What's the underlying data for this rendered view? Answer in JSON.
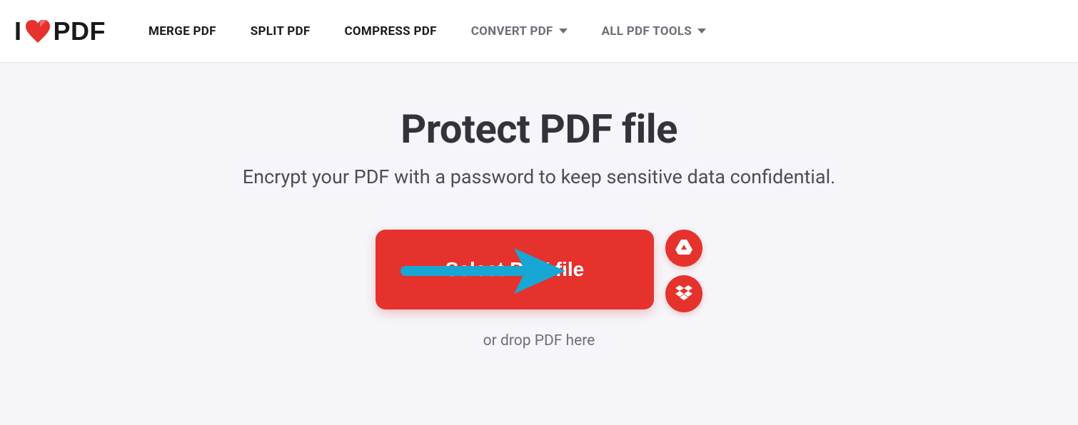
{
  "logo": {
    "left": "I",
    "right": "PDF"
  },
  "nav": {
    "merge": "MERGE PDF",
    "split": "SPLIT PDF",
    "compress": "COMPRESS PDF",
    "convert": "CONVERT PDF",
    "all_tools": "ALL PDF TOOLS"
  },
  "main": {
    "title": "Protect PDF file",
    "subtitle": "Encrypt your PDF with a password to keep sensitive data confidential.",
    "select_button": "Select PDF file",
    "drop_hint": "or drop PDF here"
  },
  "colors": {
    "accent": "#e5322d",
    "text_dark": "#33333b",
    "text_muted": "#6e6e78",
    "arrow": "#17a7d4"
  }
}
